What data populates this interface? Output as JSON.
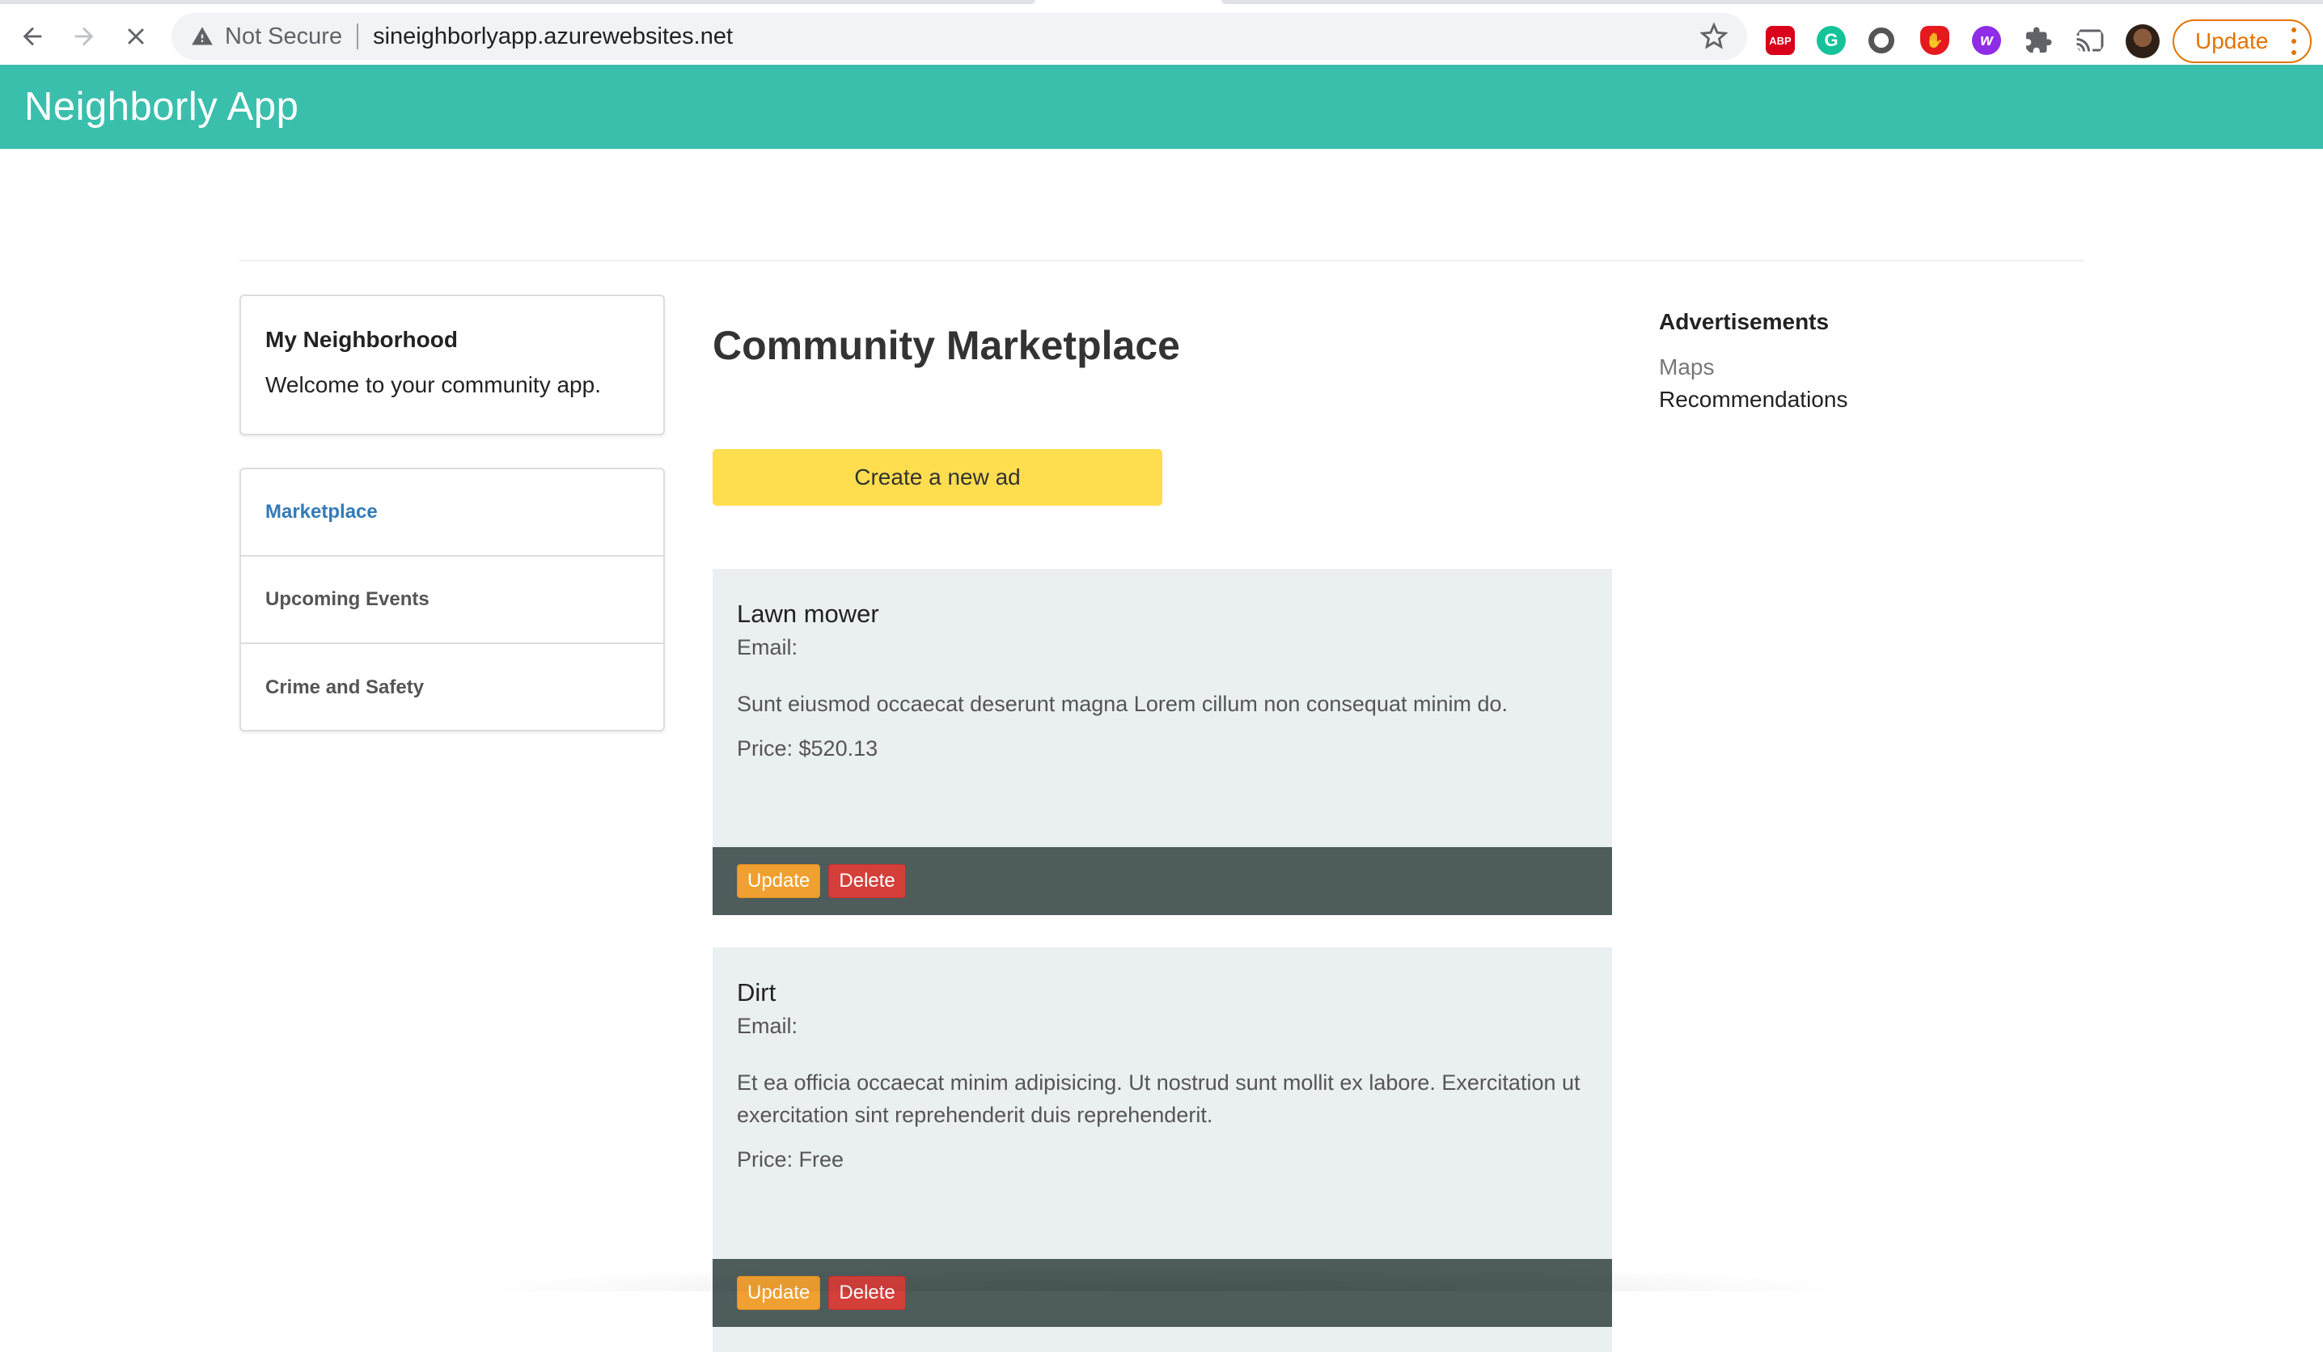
{
  "browser": {
    "security_label": "Not Secure",
    "url": "sineighborlyapp.azurewebsites.net",
    "update_label": "Update",
    "extensions": {
      "abp_label": "ABP",
      "grammarly_label": "G",
      "wappalyzer_label": "w"
    }
  },
  "header": {
    "brand": "Neighborly App"
  },
  "welcome_card": {
    "title": "My Neighborhood",
    "text": "Welcome to your community app."
  },
  "nav": {
    "items": [
      {
        "label": "Marketplace",
        "active": true
      },
      {
        "label": "Upcoming Events",
        "active": false
      },
      {
        "label": "Crime and Safety",
        "active": false
      }
    ]
  },
  "main": {
    "title": "Community Marketplace",
    "create_button": "Create a new ad",
    "ads": [
      {
        "title": "Lawn mower",
        "email_label": "Email:",
        "description": "Sunt eiusmod occaecat deserunt magna Lorem cillum non consequat minim do.",
        "price": "Price: $520.13",
        "update_label": "Update",
        "delete_label": "Delete"
      },
      {
        "title": "Dirt",
        "email_label": "Email:",
        "description": "Et ea officia occaecat minim adipisicing. Ut nostrud sunt mollit ex labore. Exercitation ut exercitation sint reprehenderit duis reprehenderit.",
        "price": "Price: Free",
        "update_label": "Update",
        "delete_label": "Delete"
      }
    ]
  },
  "sidebar_right": {
    "title": "Advertisements",
    "links": [
      "Maps",
      "Recommendations"
    ]
  },
  "colors": {
    "header_bg": "#3bbfad",
    "create_button_bg": "#fedd4e",
    "ad_card_bg": "#eaeff2",
    "ad_footer_bg": "#4e5c5c",
    "update_button": "#f0a030",
    "delete_button": "#d43f3a",
    "active_nav": "#337ab7"
  }
}
